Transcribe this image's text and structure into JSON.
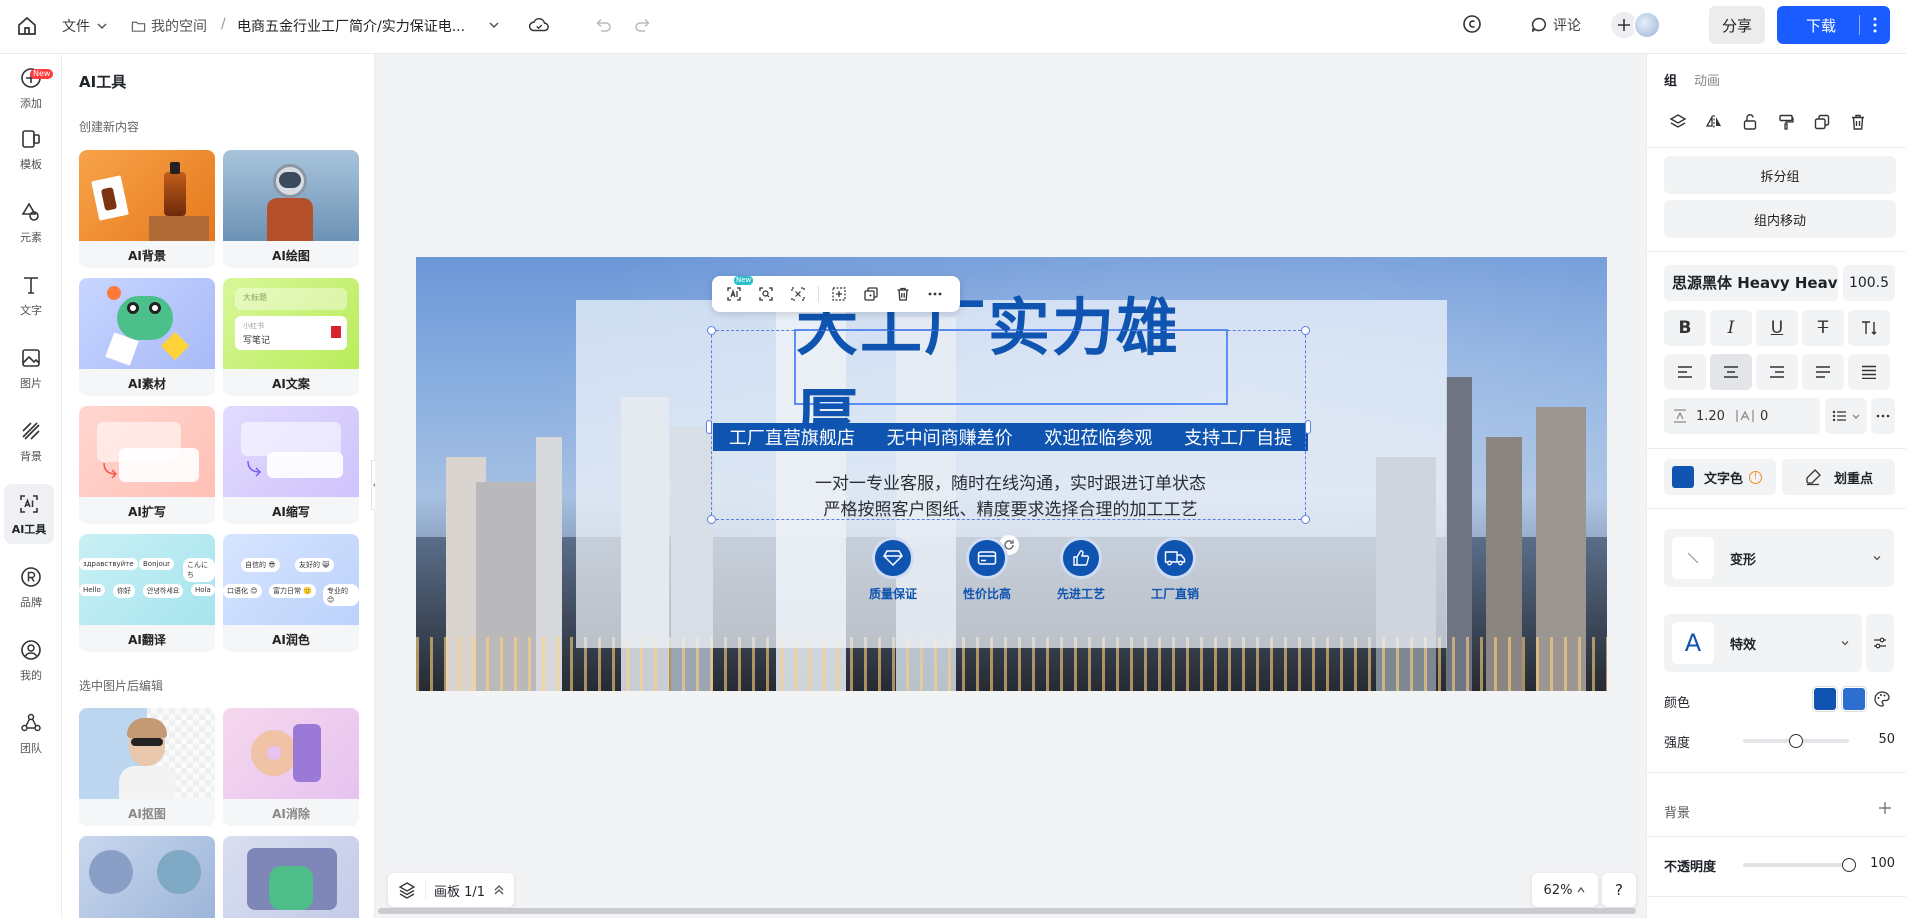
{
  "topbar": {
    "file_menu": "文件",
    "my_space": "我的空间",
    "breadcrumb_sep": "/",
    "doc_title": "电商五金行业工厂简介/实力保证电...",
    "comment": "评论",
    "share": "分享",
    "download": "下载"
  },
  "leftnav": {
    "items": [
      {
        "label": "添加",
        "badge": "New"
      },
      {
        "label": "模板"
      },
      {
        "label": "元素"
      },
      {
        "label": "文字"
      },
      {
        "label": "图片"
      },
      {
        "label": "背景"
      },
      {
        "label": "AI工具"
      },
      {
        "label": "品牌"
      },
      {
        "label": "我的"
      },
      {
        "label": "团队"
      }
    ]
  },
  "aipanel": {
    "title": "AI工具",
    "section_create": "创建新内容",
    "section_edit": "选中图片后编辑",
    "cards": [
      {
        "label": "AI背景"
      },
      {
        "label": "AI绘图"
      },
      {
        "label": "AI素材"
      },
      {
        "label": "AI文案"
      },
      {
        "label": "AI扩写"
      },
      {
        "label": "AI缩写"
      },
      {
        "label": "AI翻译"
      },
      {
        "label": "AI润色"
      },
      {
        "label": "AI抠图"
      },
      {
        "label": "AI消除"
      }
    ],
    "thumb_text": {
      "copy_tag": "大标题",
      "copy_small": "小红书",
      "copy_main": "写笔记",
      "translate": [
        "здравствуйте",
        "Bonjour",
        "こんにち",
        "Hello",
        "你好",
        "안녕하세요",
        "Hola"
      ],
      "polish": [
        "自信的 😎",
        "友好的 😸",
        "口语化 😊",
        "富力日常 🙂",
        "专业的 😊"
      ]
    }
  },
  "banner": {
    "headline": "大工厂实力雄厚",
    "strip": [
      "工厂直营旗舰店",
      "无中间商赚差价",
      "欢迎莅临参观",
      "支持工厂自提"
    ],
    "line1": "一对一专业客服，随时在线沟通，实时跟进订单状态",
    "line2": "严格按照客户图纸、精度要求选择合理的加工工艺",
    "features": [
      {
        "icon": "diamond-icon",
        "label": "质量保证"
      },
      {
        "icon": "card-icon",
        "label": "性价比高"
      },
      {
        "icon": "thumbs-up-icon",
        "label": "先进工艺"
      },
      {
        "icon": "truck-icon",
        "label": "工厂直销"
      }
    ],
    "toolbar_badge": "New"
  },
  "bottombar": {
    "artboard": "画板 1/1",
    "zoom": "62%",
    "help": "?"
  },
  "rightpanel": {
    "tab_group": "组",
    "tab_anim": "动画",
    "ungroup": "拆分组",
    "move_in_group": "组内移动",
    "font_name": "思源黑体 Heavy Heavy",
    "font_size": "100.5",
    "line_height": "1.20",
    "letter_spacing": "0",
    "text_color": "文字色",
    "highlight": "划重点",
    "transform": "变形",
    "effects": "特效",
    "color_label": "颜色",
    "strength_label": "强度",
    "strength_value": "50",
    "strength_level": 0.5,
    "background_label": "背景",
    "opacity_label": "不透明度",
    "opacity_value": "100",
    "opacity_level": 1.0,
    "colors": {
      "primary": "#0f54b0",
      "secondary": "#2d6fcf",
      "accent": "#1a5cff"
    }
  }
}
